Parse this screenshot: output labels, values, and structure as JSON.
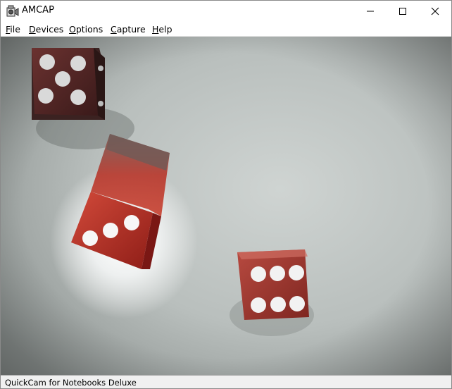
{
  "window": {
    "title": "AMCAP",
    "icon": "camera-app-icon"
  },
  "caption_buttons": {
    "minimize_icon": "minimize-icon",
    "maximize_icon": "maximize-icon",
    "close_icon": "close-icon"
  },
  "menu": {
    "items": [
      {
        "label": "File"
      },
      {
        "label": "Devices"
      },
      {
        "label": "Options"
      },
      {
        "label": "Capture"
      },
      {
        "label": "Help"
      }
    ]
  },
  "preview": {
    "description_icon": "video-preview",
    "dice_colors": {
      "body": "#b01818",
      "pip": "#f4f4f4",
      "surface": "#c6cbc9"
    }
  },
  "status": {
    "text": "QuickCam for Notebooks Deluxe"
  }
}
